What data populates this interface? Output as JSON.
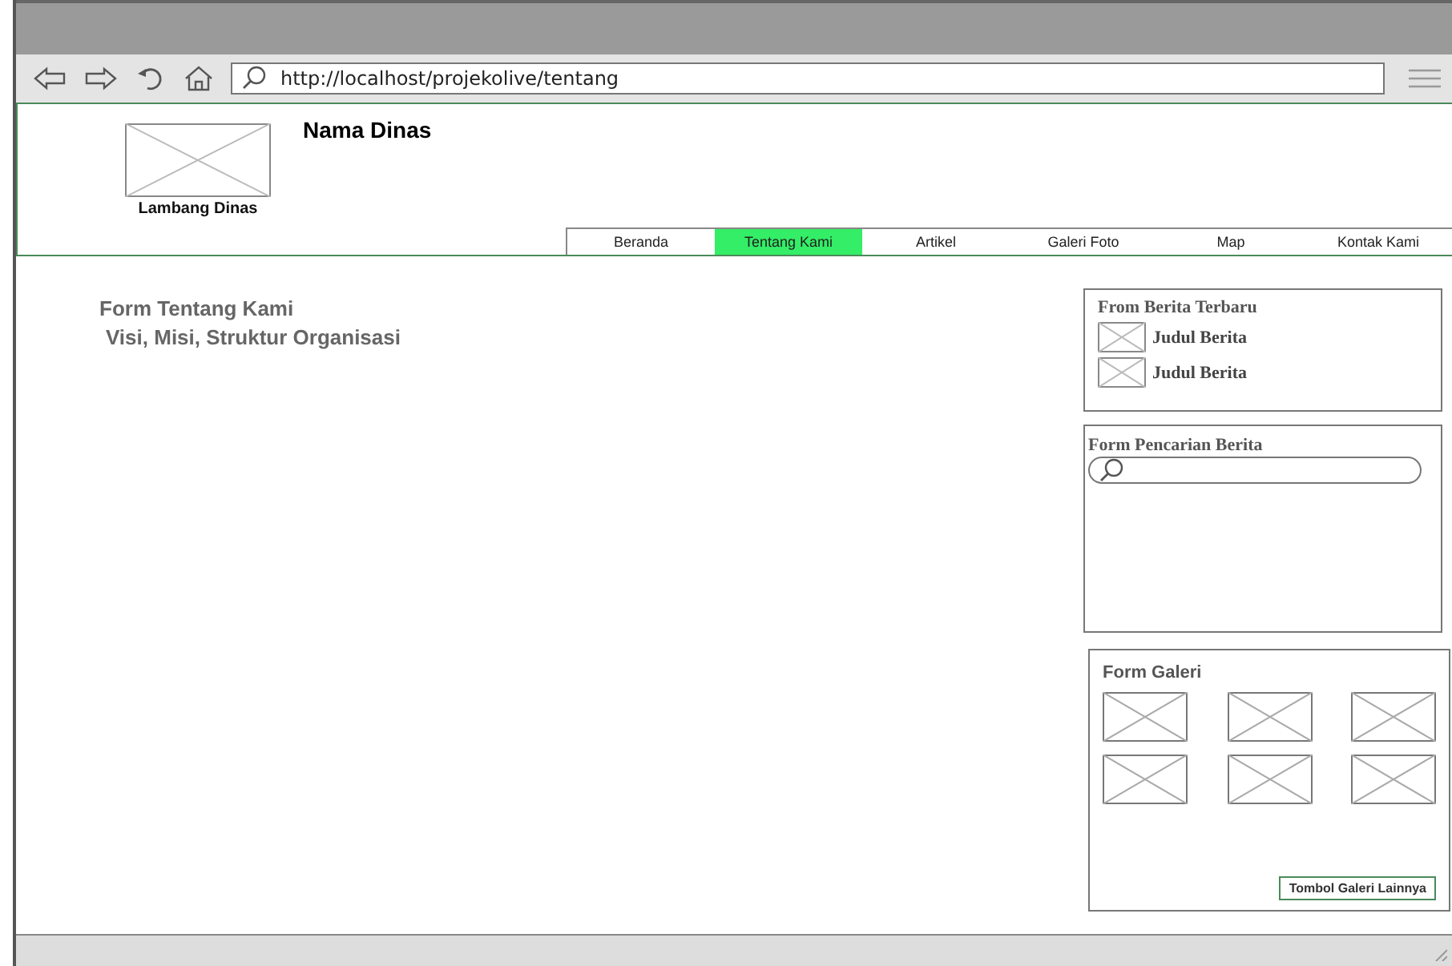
{
  "browser": {
    "url": "http://localhost/projekolive/tentang"
  },
  "header": {
    "logo_caption": "Lambang Dinas",
    "agency_name": "Nama Dinas"
  },
  "nav": [
    {
      "label": "Beranda",
      "selected": false
    },
    {
      "label": "Tentang Kami",
      "selected": true
    },
    {
      "label": "Artikel",
      "selected": false
    },
    {
      "label": "Galeri Foto",
      "selected": false
    },
    {
      "label": "Map",
      "selected": false
    },
    {
      "label": "Kontak Kami",
      "selected": false
    }
  ],
  "main": {
    "title": "Form Tentang Kami",
    "subtitle": "Visi, Misi, Struktur Organisasi"
  },
  "latest_news": {
    "title": "From Berita Terbaru",
    "items": [
      {
        "title": "Judul Berita"
      },
      {
        "title": "Judul Berita"
      }
    ]
  },
  "news_search": {
    "title": "Form Pencarian Berita"
  },
  "gallery": {
    "title": "Form Galeri",
    "images": [
      {
        "kind": "placeholder"
      },
      {
        "kind": "placeholder"
      },
      {
        "kind": "placeholder"
      },
      {
        "kind": "placeholder"
      },
      {
        "kind": "placeholder"
      },
      {
        "kind": "placeholder"
      }
    ],
    "button": "Tombol Galeri Lainnya"
  }
}
